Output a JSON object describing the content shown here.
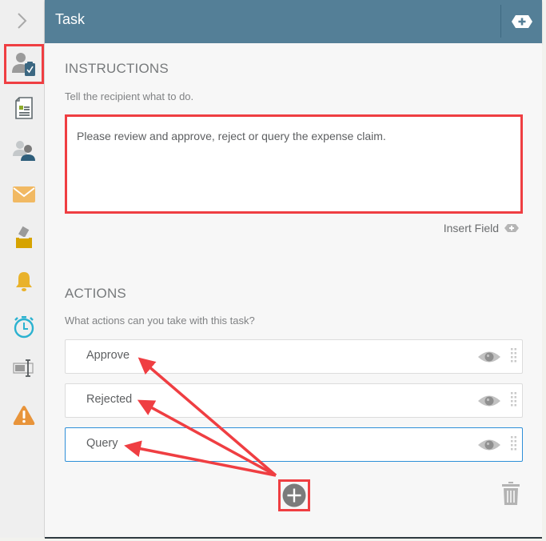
{
  "header": {
    "title": "Task",
    "add_icon": "add-field-icon"
  },
  "sidebar": {
    "expand_icon": "chevron-right-icon",
    "items": [
      {
        "name": "task",
        "icon": "user-clipboard-icon",
        "selected": true
      },
      {
        "name": "form",
        "icon": "form-document-icon",
        "selected": false
      },
      {
        "name": "recipients",
        "icon": "users-icon",
        "selected": false
      },
      {
        "name": "email",
        "icon": "envelope-icon",
        "selected": false
      },
      {
        "name": "ballot",
        "icon": "ballot-box-icon",
        "selected": false
      },
      {
        "name": "notifications",
        "icon": "bell-icon",
        "selected": false
      },
      {
        "name": "timer",
        "icon": "stopwatch-icon",
        "selected": false
      },
      {
        "name": "text-input",
        "icon": "text-field-icon",
        "selected": false
      },
      {
        "name": "warnings",
        "icon": "warning-icon",
        "selected": false
      }
    ]
  },
  "instructions": {
    "title": "INSTRUCTIONS",
    "subtitle": "Tell the recipient what to do.",
    "text": "Please review and approve, reject or query the expense claim.",
    "insert_field_label": "Insert Field"
  },
  "actions": {
    "title": "ACTIONS",
    "subtitle": "What actions can you take with this task?",
    "items": [
      {
        "label": "Approve",
        "active": false
      },
      {
        "label": "Rejected",
        "active": false
      },
      {
        "label": "Query",
        "active": true
      }
    ],
    "add_icon": "plus-circle-icon",
    "delete_icon": "trash-icon"
  },
  "colors": {
    "header": "#547f97",
    "highlight": "#ef3e42",
    "active_border": "#2e8fd8"
  }
}
